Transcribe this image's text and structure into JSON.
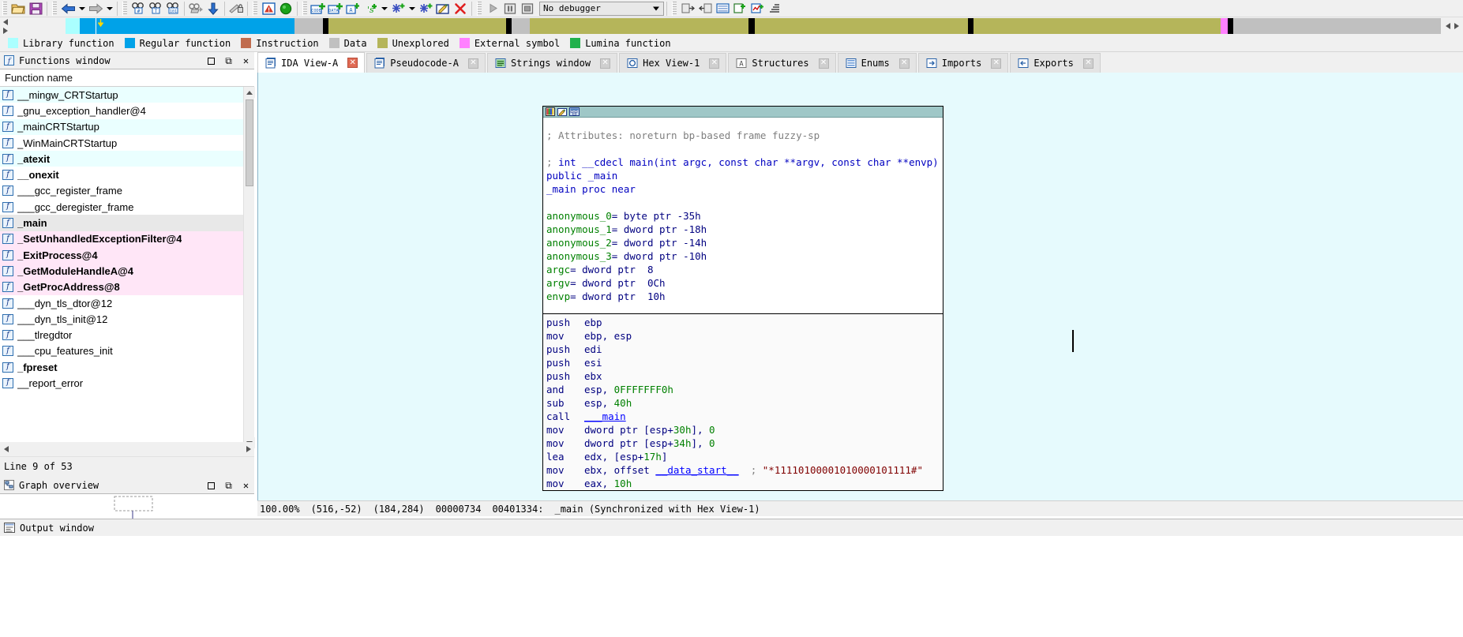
{
  "toolbar": {
    "buttons": [
      {
        "name": "open-file-icon",
        "glyph": "folder"
      },
      {
        "name": "save-file-icon",
        "glyph": "save"
      },
      {
        "name": "navigate-back-icon",
        "glyph": "arrow-left"
      },
      {
        "name": "navigate-back-dropdown-icon",
        "glyph": "caret"
      },
      {
        "name": "navigate-forward-icon",
        "glyph": "arrow-right"
      },
      {
        "name": "navigate-forward-dropdown-icon",
        "glyph": "caret"
      },
      {
        "name": "search-hex-icon",
        "glyph": "binoc-hash"
      },
      {
        "name": "search-text-icon",
        "glyph": "binoc-text"
      },
      {
        "name": "search-immediate-icon",
        "glyph": "binoc-101"
      },
      {
        "name": "search-next-icon",
        "glyph": "binoc-next"
      },
      {
        "name": "jump-to-address-icon",
        "glyph": "down-arrow"
      },
      {
        "name": "jump-to-xref-icon",
        "glyph": "lock-pen"
      },
      {
        "name": "error-list-icon",
        "glyph": "warning"
      },
      {
        "name": "run-to-icon",
        "glyph": "green-circle"
      },
      {
        "name": "make-code-icon",
        "glyph": "code-plus"
      },
      {
        "name": "make-data-icon",
        "glyph": "data-plus"
      },
      {
        "name": "make-array-icon",
        "glyph": "array-plus"
      },
      {
        "name": "make-string-icon",
        "glyph": "string-plus"
      },
      {
        "name": "make-string-dropdown-icon",
        "glyph": "caret"
      },
      {
        "name": "make-struct-icon",
        "glyph": "snowflake-plus"
      },
      {
        "name": "make-struct-dropdown-icon",
        "glyph": "caret"
      },
      {
        "name": "create-struct-icon",
        "glyph": "snowflake-plus2"
      },
      {
        "name": "edit-function-icon",
        "glyph": "edit-pencil"
      },
      {
        "name": "undefine-icon",
        "glyph": "red-x"
      },
      {
        "name": "debugger-run-icon",
        "glyph": "play"
      },
      {
        "name": "debugger-pause-icon",
        "glyph": "pause"
      },
      {
        "name": "debugger-stop-icon",
        "glyph": "stop"
      }
    ],
    "debugger_select_value": "No debugger",
    "after_buttons": [
      {
        "name": "attach-process-icon",
        "glyph": "attach"
      },
      {
        "name": "detach-process-icon",
        "glyph": "detach"
      },
      {
        "name": "breakpoint-list-icon",
        "glyph": "bpt-list"
      },
      {
        "name": "watch-list-icon",
        "glyph": "watch"
      },
      {
        "name": "tracing-icon",
        "glyph": "trace"
      },
      {
        "name": "stack-trace-icon",
        "glyph": "stack"
      }
    ]
  },
  "navband": {
    "segments": [
      {
        "color": "#aaffff",
        "left_pct": 3.8,
        "width_pct": 1.0
      },
      {
        "color": "#00a2e8",
        "left_pct": 4.8,
        "width_pct": 15.0
      },
      {
        "color": "#c0c0c0",
        "left_pct": 19.8,
        "width_pct": 2.0
      },
      {
        "color": "#000000",
        "left_pct": 21.8,
        "width_pct": 0.4
      },
      {
        "color": "#b5b55a",
        "left_pct": 22.2,
        "width_pct": 12.4
      },
      {
        "color": "#000000",
        "left_pct": 34.6,
        "width_pct": 0.4
      },
      {
        "color": "#c0c0c0",
        "left_pct": 35.0,
        "width_pct": 1.3
      },
      {
        "color": "#b5b55a",
        "left_pct": 36.3,
        "width_pct": 15.3
      },
      {
        "color": "#000000",
        "left_pct": 51.6,
        "width_pct": 0.4
      },
      {
        "color": "#b5b55a",
        "left_pct": 52.0,
        "width_pct": 14.9
      },
      {
        "color": "#000000",
        "left_pct": 66.9,
        "width_pct": 0.4
      },
      {
        "color": "#b5b55a",
        "left_pct": 67.3,
        "width_pct": 17.3
      },
      {
        "color": "#ff80ff",
        "left_pct": 84.6,
        "width_pct": 0.5
      },
      {
        "color": "#000000",
        "left_pct": 85.1,
        "width_pct": 0.4
      },
      {
        "color": "#c0c0c0",
        "left_pct": 85.5,
        "width_pct": 14.5
      }
    ],
    "cursor_pct": 5.9,
    "marker_pct": 6.1,
    "marker_color": "#ffd800"
  },
  "legend": {
    "items": [
      {
        "label": "Library function",
        "color": "#aaffff"
      },
      {
        "label": "Regular function",
        "color": "#00a2e8"
      },
      {
        "label": "Instruction",
        "color": "#c06c4e"
      },
      {
        "label": "Data",
        "color": "#c0c0c0"
      },
      {
        "label": "Unexplored",
        "color": "#b5b55a"
      },
      {
        "label": "External symbol",
        "color": "#ff80ff"
      },
      {
        "label": "Lumina function",
        "color": "#22b14c"
      }
    ]
  },
  "functions_panel": {
    "title": "Functions window",
    "title_icon": "function-icon",
    "column_header": "Function name",
    "line_info": "Line 9 of 53",
    "controls": [
      {
        "name": "panel-restore-button",
        "glyph": "▣"
      },
      {
        "name": "panel-float-button",
        "glyph": "⧉"
      },
      {
        "name": "panel-close-button",
        "glyph": "✕"
      }
    ],
    "rows": [
      {
        "name": "__mingw_CRTStartup",
        "bg": "#eaffff",
        "bold": false
      },
      {
        "name": "_gnu_exception_handler@4",
        "bg": "#ffffff",
        "bold": false
      },
      {
        "name": "_mainCRTStartup",
        "bg": "#eaffff",
        "bold": false
      },
      {
        "name": "_WinMainCRTStartup",
        "bg": "#ffffff",
        "bold": false
      },
      {
        "name": "_atexit",
        "bg": "#eaffff",
        "bold": true
      },
      {
        "name": "__onexit",
        "bg": "#ffffff",
        "bold": true
      },
      {
        "name": "___gcc_register_frame",
        "bg": "#ffffff",
        "bold": false
      },
      {
        "name": "___gcc_deregister_frame",
        "bg": "#ffffff",
        "bold": false
      },
      {
        "name": "_main",
        "bg": "#e8e8e8",
        "bold": true
      },
      {
        "name": "_SetUnhandledExceptionFilter@4",
        "bg": "#ffe6f7",
        "bold": true
      },
      {
        "name": "_ExitProcess@4",
        "bg": "#ffe6f7",
        "bold": true
      },
      {
        "name": "_GetModuleHandleA@4",
        "bg": "#ffe6f7",
        "bold": true
      },
      {
        "name": "_GetProcAddress@8",
        "bg": "#ffe6f7",
        "bold": true
      },
      {
        "name": "___dyn_tls_dtor@12",
        "bg": "#ffffff",
        "bold": false
      },
      {
        "name": "___dyn_tls_init@12",
        "bg": "#ffffff",
        "bold": false
      },
      {
        "name": "___tlregdtor",
        "bg": "#ffffff",
        "bold": false
      },
      {
        "name": "___cpu_features_init",
        "bg": "#ffffff",
        "bold": false
      },
      {
        "name": "_fpreset",
        "bg": "#ffffff",
        "bold": true
      },
      {
        "name": "__report_error",
        "bg": "#ffffff",
        "bold": false
      }
    ]
  },
  "graph_overview": {
    "title": "Graph overview",
    "title_icon": "graph-icon",
    "controls": [
      {
        "name": "graph-restore-button",
        "glyph": "▣"
      },
      {
        "name": "graph-float-button",
        "glyph": "⧉"
      },
      {
        "name": "graph-close-button",
        "glyph": "✕"
      }
    ]
  },
  "tabs": [
    {
      "label": "IDA View-A",
      "icon": "ida-view-icon",
      "active": true,
      "close": "red"
    },
    {
      "label": "Pseudocode-A",
      "icon": "pseudocode-icon",
      "active": false,
      "close": "grey"
    },
    {
      "label": "Strings window",
      "icon": "strings-icon",
      "active": false,
      "close": "grey"
    },
    {
      "label": "Hex View-1",
      "icon": "hexview-icon",
      "active": false,
      "close": "grey"
    },
    {
      "label": "Structures",
      "icon": "structures-icon",
      "active": false,
      "close": "grey"
    },
    {
      "label": "Enums",
      "icon": "enums-icon",
      "active": false,
      "close": "grey"
    },
    {
      "label": "Imports",
      "icon": "imports-icon",
      "active": false,
      "close": "grey"
    },
    {
      "label": "Exports",
      "icon": "exports-icon",
      "active": false,
      "close": "grey"
    }
  ],
  "graph_node": {
    "header_icons": [
      "color-palette-icon",
      "rename-icon",
      "group-nodes-icon"
    ],
    "header_lines": [
      {
        "text": "; Attributes: noreturn bp-based frame fuzzy-sp",
        "cls": "c-cmt"
      }
    ],
    "signature_lines": [
      {
        "text": "; int __cdecl main(int argc, const char **argv, const char **envp)",
        "cls": "c-kw"
      },
      {
        "text": "public _main",
        "cls": "c-kw"
      },
      {
        "text": "_main proc near",
        "cls": "c-kw"
      }
    ],
    "locals": [
      {
        "name": "anonymous_0",
        "rest": "= byte ptr -35h"
      },
      {
        "name": "anonymous_1",
        "rest": "= dword ptr -18h"
      },
      {
        "name": "anonymous_2",
        "rest": "= dword ptr -14h"
      },
      {
        "name": "anonymous_3",
        "rest": "= dword ptr -10h"
      },
      {
        "name": "argc",
        "rest": "= dword ptr  8"
      },
      {
        "name": "argv",
        "rest": "= dword ptr  0Ch"
      },
      {
        "name": "envp",
        "rest": "= dword ptr  10h"
      }
    ],
    "instructions": [
      {
        "mnemonic": "push",
        "operands": "ebp"
      },
      {
        "mnemonic": "mov",
        "operands": "ebp, esp"
      },
      {
        "mnemonic": "push",
        "operands": "edi"
      },
      {
        "mnemonic": "push",
        "operands": "esi"
      },
      {
        "mnemonic": "push",
        "operands": "ebx"
      },
      {
        "mnemonic": "and",
        "operands": "esp, 0FFFFFFF0h",
        "num": "0FFFFFFF0h"
      },
      {
        "mnemonic": "sub",
        "operands": "esp, 40h",
        "num": "40h"
      },
      {
        "mnemonic": "call",
        "operands": "___main",
        "call": true
      },
      {
        "mnemonic": "mov",
        "operands": "dword ptr [esp+30h], 0"
      },
      {
        "mnemonic": "mov",
        "operands": "dword ptr [esp+34h], 0"
      },
      {
        "mnemonic": "lea",
        "operands": "edx, [esp+17h]"
      },
      {
        "mnemonic": "mov",
        "operands": "ebx, offset __data_start__",
        "comment": "; \"*11110100001010000101111#\""
      },
      {
        "mnemonic": "mov",
        "operands": "eax, 10h"
      }
    ]
  },
  "view_status": {
    "zoom": "100.00%",
    "coord1": "(516,-52)",
    "coord2": "(184,284)",
    "file_offset": "00000734",
    "address": "00401334:",
    "symbol": "_main (Synchronized with Hex View-1)"
  },
  "output_window": {
    "title": "Output window",
    "title_icon": "output-icon"
  }
}
